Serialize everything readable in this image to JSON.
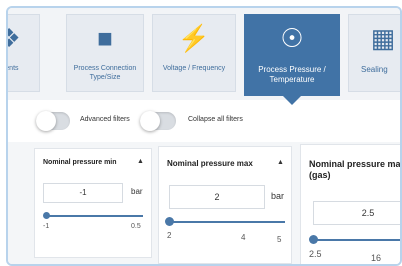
{
  "tabs": [
    {
      "label": "...ents",
      "icon": "tree-icon"
    },
    {
      "label": "Process Connection Type/Size",
      "icon": "pipe-connection-icon"
    },
    {
      "label": "Voltage / Frequency",
      "icon": "lightning-icon"
    },
    {
      "label": "Process Pressure / Temperature",
      "icon": "pressure-gauge-icon",
      "active": true
    },
    {
      "label": "Sealing",
      "icon": "sealing-icon"
    }
  ],
  "filters": {
    "advanced_label": "Advanced filters",
    "collapse_label": "Collapse all filters"
  },
  "cards": [
    {
      "title": "Nominal pressure min",
      "value": "-1",
      "unit": "bar",
      "min_label": "-1",
      "max_label": "0.5"
    },
    {
      "title": "Nominal pressure max",
      "value": "2",
      "unit": "bar",
      "min_label": "2",
      "mid_label": "4",
      "max_label": "5"
    },
    {
      "title": "Nominal pressure ma (gas)",
      "value": "2.5",
      "min_label": "2.5",
      "mid_label": "16"
    }
  ],
  "colors": {
    "accent": "#4173a6",
    "tab_bg": "#e7ebf1"
  }
}
